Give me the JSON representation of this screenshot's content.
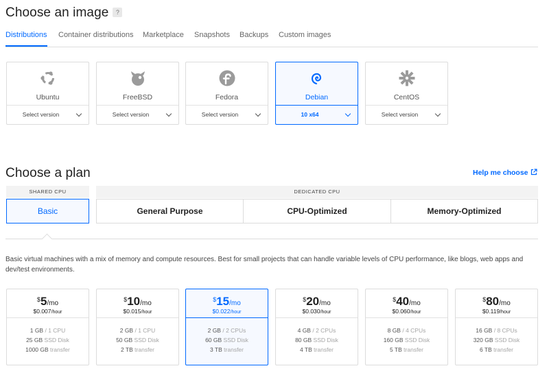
{
  "image_section": {
    "title": "Choose an image",
    "help_badge": "?",
    "tabs": [
      {
        "label": "Distributions",
        "active": true
      },
      {
        "label": "Container distributions",
        "active": false
      },
      {
        "label": "Marketplace",
        "active": false
      },
      {
        "label": "Snapshots",
        "active": false
      },
      {
        "label": "Backups",
        "active": false
      },
      {
        "label": "Custom images",
        "active": false
      }
    ],
    "distributions": [
      {
        "name": "Ubuntu",
        "version": "Select version",
        "icon": "ubuntu-icon",
        "selected": false
      },
      {
        "name": "FreeBSD",
        "version": "Select version",
        "icon": "freebsd-icon",
        "selected": false
      },
      {
        "name": "Fedora",
        "version": "Select version",
        "icon": "fedora-icon",
        "selected": false
      },
      {
        "name": "Debian",
        "version": "10 x64",
        "icon": "debian-icon",
        "selected": true
      },
      {
        "name": "CentOS",
        "version": "Select version",
        "icon": "centos-icon",
        "selected": false
      }
    ]
  },
  "plan_section": {
    "title": "Choose a plan",
    "help_link": "Help me choose",
    "shared_cpu": {
      "header": "SHARED CPU",
      "options": [
        {
          "label": "Basic",
          "selected": true
        }
      ]
    },
    "dedicated_cpu": {
      "header": "DEDICATED CPU",
      "options": [
        {
          "label": "General Purpose",
          "selected": false
        },
        {
          "label": "CPU-Optimized",
          "selected": false
        },
        {
          "label": "Memory-Optimized",
          "selected": false
        }
      ]
    },
    "description": "Basic virtual machines with a mix of memory and compute resources. Best for small projects that can handle variable levels of CPU performance, like blogs, web apps and dev/test environments.",
    "currency": "$",
    "per_month": "/mo",
    "per_hour": "/hour",
    "plans": [
      {
        "price": "5",
        "hourly": "$0.007",
        "mem": "1 GB",
        "cpu": "/ 1 CPU",
        "disk": "25 GB",
        "disk_label": "SSD Disk",
        "transfer": "1000 GB",
        "transfer_label": "transfer",
        "selected": false
      },
      {
        "price": "10",
        "hourly": "$0.015",
        "mem": "2 GB",
        "cpu": "/ 1 CPU",
        "disk": "50 GB",
        "disk_label": "SSD Disk",
        "transfer": "2 TB",
        "transfer_label": "transfer",
        "selected": false
      },
      {
        "price": "15",
        "hourly": "$0.022",
        "mem": "2 GB",
        "cpu": "/ 2 CPUs",
        "disk": "60 GB",
        "disk_label": "SSD Disk",
        "transfer": "3 TB",
        "transfer_label": "transfer",
        "selected": true
      },
      {
        "price": "20",
        "hourly": "$0.030",
        "mem": "4 GB",
        "cpu": "/ 2 CPUs",
        "disk": "80 GB",
        "disk_label": "SSD Disk",
        "transfer": "4 TB",
        "transfer_label": "transfer",
        "selected": false
      },
      {
        "price": "40",
        "hourly": "$0.060",
        "mem": "8 GB",
        "cpu": "/ 4 CPUs",
        "disk": "160 GB",
        "disk_label": "SSD Disk",
        "transfer": "5 TB",
        "transfer_label": "transfer",
        "selected": false
      },
      {
        "price": "80",
        "hourly": "$0.119",
        "mem": "16 GB",
        "cpu": "/ 8 CPUs",
        "disk": "320 GB",
        "disk_label": "SSD Disk",
        "transfer": "6 TB",
        "transfer_label": "transfer",
        "selected": false
      }
    ]
  },
  "colors": {
    "accent": "#0069ff",
    "border": "#dcdcdc",
    "icon_gray": "#9b9b9b"
  }
}
